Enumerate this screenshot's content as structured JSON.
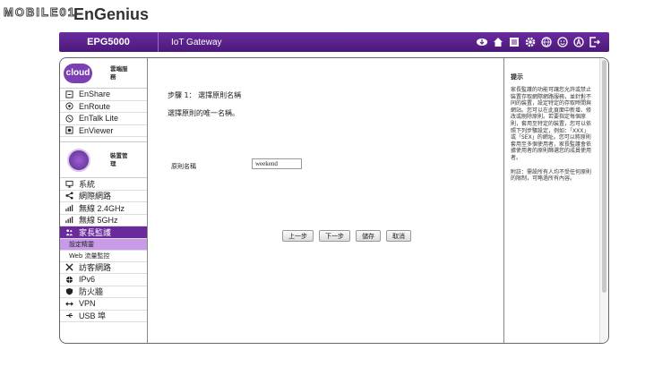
{
  "watermark": "MOBILE01",
  "brand": "EnGenius",
  "header": {
    "model": "EPG5000",
    "subtitle": "IoT Gateway",
    "icons": [
      "download-icon",
      "home-icon",
      "list-icon",
      "gear-icon",
      "globe-icon",
      "smiley-icon",
      "a-icon",
      "logout-icon"
    ]
  },
  "sidebar": {
    "cloud_section": {
      "logo": "cloud",
      "title": "雲端服務"
    },
    "cloud_items": [
      {
        "label": "EnShare",
        "icon": "share-icon"
      },
      {
        "label": "EnRoute",
        "icon": "route-icon"
      },
      {
        "label": "EnTalk Lite",
        "icon": "phone-icon"
      },
      {
        "label": "EnViewer",
        "icon": "camera-icon"
      }
    ],
    "device_section": {
      "title": "裝置管理"
    },
    "device_items": [
      {
        "label": "系統",
        "icon": "monitor-icon"
      },
      {
        "label": "網際網路",
        "icon": "network-icon"
      },
      {
        "label": "無線 2.4GHz",
        "icon": "wifi-icon"
      },
      {
        "label": "無線 5GHz",
        "icon": "wifi-icon"
      },
      {
        "label": "家長監護",
        "icon": "family-icon"
      }
    ],
    "sub_items": [
      "設定精靈",
      "Web 流量監控"
    ],
    "more_items": [
      {
        "label": "訪客網路",
        "icon": "tools-icon"
      },
      {
        "label": "IPv6",
        "icon": "globe-icon"
      },
      {
        "label": "防火牆",
        "icon": "shield-icon"
      },
      {
        "label": "VPN",
        "icon": "vpn-icon"
      },
      {
        "label": "USB 埠",
        "icon": "usb-icon"
      }
    ]
  },
  "content": {
    "step_title": "步驟 1： 選擇原則名稱",
    "step_desc": "選擇原則的唯一名稱。",
    "field_label": "原則名稱",
    "field_value": "weekend",
    "buttons": [
      "上一步",
      "下一步",
      "儲存",
      "取消"
    ]
  },
  "tips": {
    "title": "提示",
    "text": "家長監護的功能可讓您允許或禁止裝置存取網際網路服務，並針對不同的裝置，設定特定的存取時間與網站。您可以在此頁面中新增、修改或刪除原則。若要指定每個原則，套用至特定的裝置，您可以依照下列步驟設定，例如：「XXX」或「SEX」的網址。您可以將原則套用至多個使用者，家長監護會依據使用者的原則篩選您的成員使用者。",
    "note": "附註：需設所有人均不受任何原則的限制，可略過所有內容。"
  },
  "colors": {
    "accent": "#6a2a9e",
    "sub_active": "#c89ae8"
  }
}
